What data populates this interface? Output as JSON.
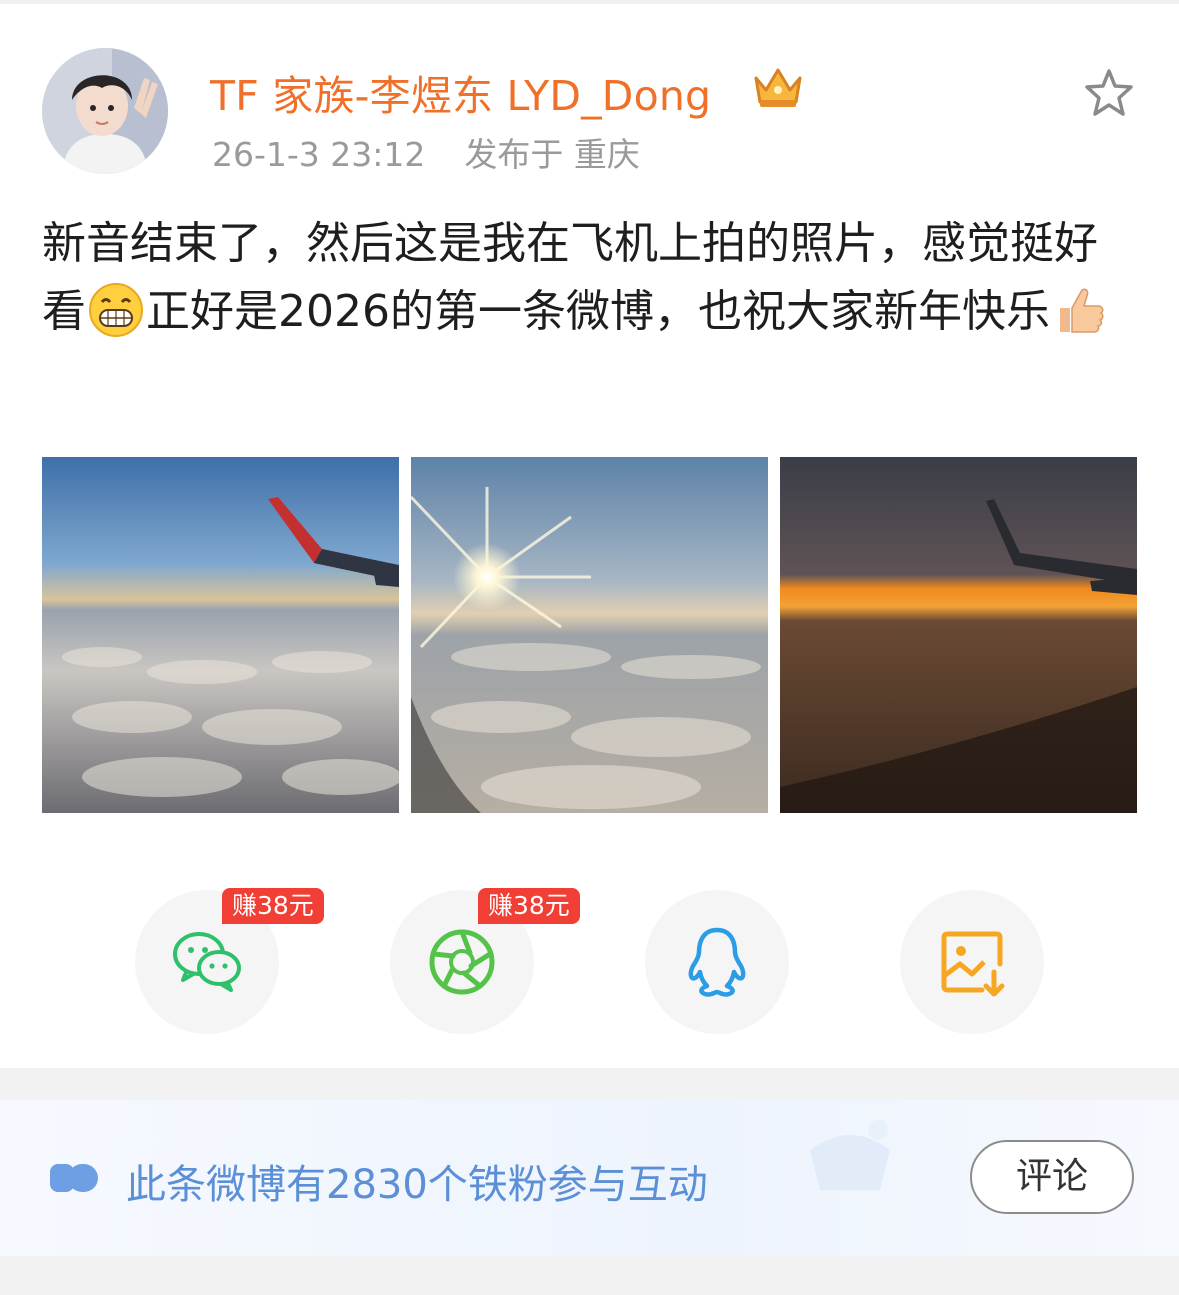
{
  "post": {
    "author_name": "TF 家族-李煜东 LYD_Dong",
    "timestamp": "26-1-3 23:12",
    "location": "发布于 重庆",
    "text_part1": "新音结束了，然后这是我在飞机上拍的照片，感觉挺好看",
    "text_part2": "正好是2026的第一条微博，也祝大家新年快乐",
    "emojis": [
      "grin-emoji",
      "thumbs-up-emoji"
    ],
    "photos": [
      "airplane-wing-over-clouds-photo",
      "sun-over-clouds-photo",
      "sunset-wing-photo"
    ]
  },
  "share": {
    "items": [
      {
        "name": "wechat",
        "badge": "赚38元",
        "color": "#2fc06b"
      },
      {
        "name": "moments",
        "badge": "赚38元",
        "color": "#55c24a"
      },
      {
        "name": "qq",
        "badge": "",
        "color": "#2d9ce6"
      },
      {
        "name": "save-image",
        "badge": "",
        "color": "#f5a623"
      }
    ]
  },
  "fans": {
    "text": "此条微博有2830个铁粉参与互动",
    "comment_label": "评论"
  },
  "colors": {
    "author": "#f0702a",
    "badge": "#f23f35",
    "fan_text": "#5b8fd6"
  }
}
